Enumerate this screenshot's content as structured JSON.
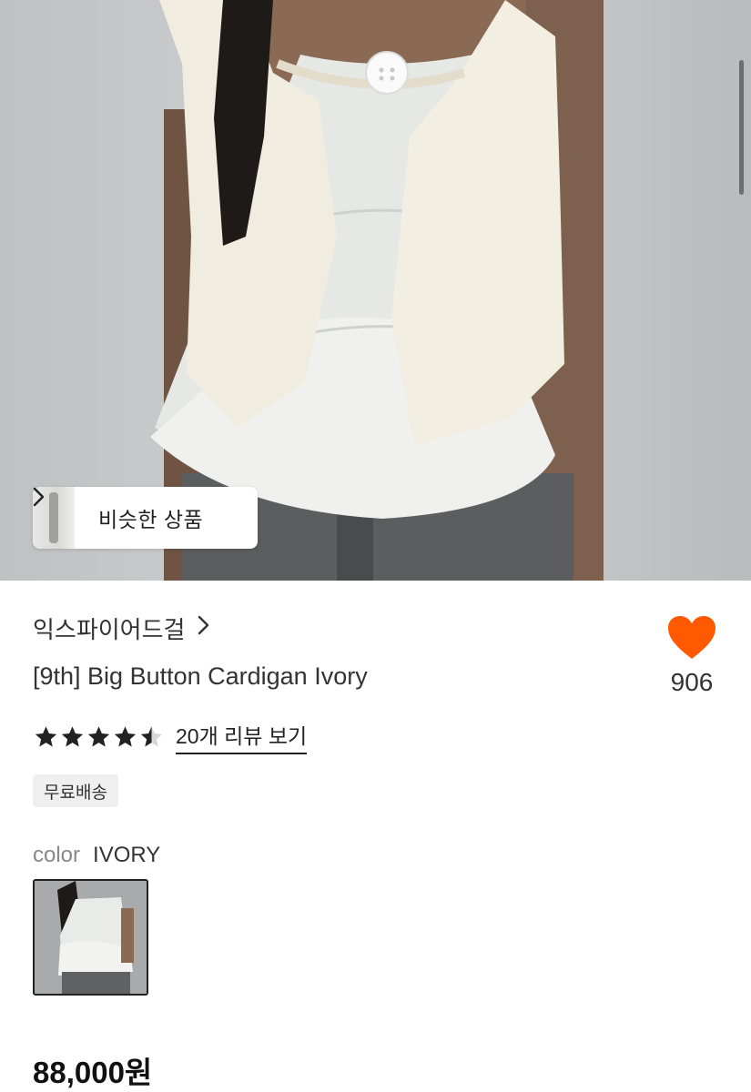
{
  "hero": {
    "similar_label": "비슷한 상품",
    "chevron_icon": "chevron-right-icon"
  },
  "product": {
    "brand": "익스파이어드걸",
    "title": "[9th] Big Button Cardigan Ivory",
    "like_count": "906",
    "like_color": "#FF5A00",
    "rating": 4.5,
    "rating_max": 5,
    "review_link": "20개 리뷰 보기",
    "badge": "무료배송",
    "color_label": "color",
    "color_value": "IVORY",
    "price": "88,000원"
  }
}
